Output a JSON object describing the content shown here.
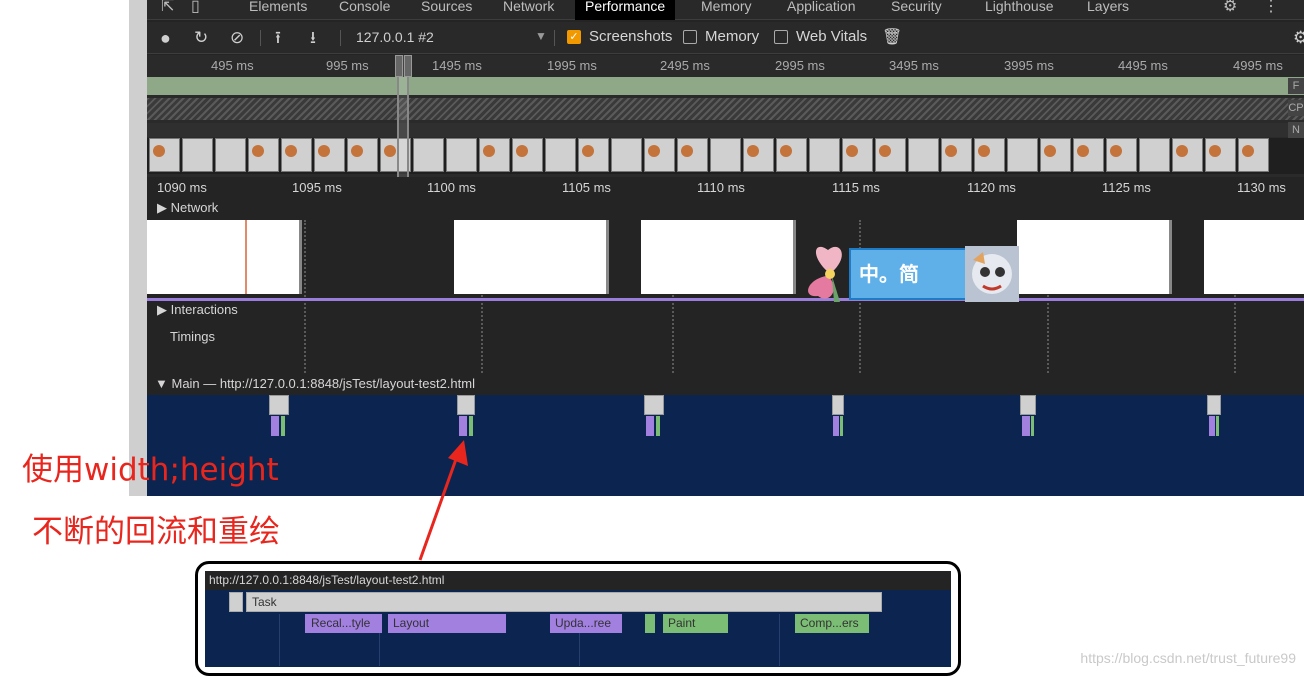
{
  "tabs": [
    "Elements",
    "Console",
    "Sources",
    "Network",
    "Performance",
    "Memory",
    "Application",
    "Security",
    "Lighthouse",
    "Layers"
  ],
  "active_tab": "Performance",
  "toolbar": {
    "profile": "127.0.0.1 #2",
    "screenshots_label": "Screenshots",
    "memory_label": "Memory",
    "webvitals_label": "Web Vitals"
  },
  "overview": {
    "ticks": [
      "495 ms",
      "995 ms",
      "1495 ms",
      "1995 ms",
      "2495 ms",
      "2995 ms",
      "3495 ms",
      "3995 ms",
      "4495 ms",
      "4995 ms"
    ],
    "fps_label": "F",
    "cpu_label": "CP",
    "net_label": "N"
  },
  "ruler": {
    "ticks": [
      "1090 ms",
      "1095 ms",
      "1100 ms",
      "1105 ms",
      "1110 ms",
      "1115 ms",
      "1120 ms",
      "1125 ms",
      "1130 ms"
    ]
  },
  "tracks": {
    "network": "Network",
    "interactions": "Interactions",
    "timings": "Timings",
    "main": "Main — http://127.0.0.1:8848/jsTest/layout-test2.html"
  },
  "sticker": {
    "text": "中。简"
  },
  "annotation": {
    "line1": "使用width;height",
    "line2": "不断的回流和重绘"
  },
  "zoom": {
    "url": "http://127.0.0.1:8848/jsTest/layout-test2.html",
    "task": "Task",
    "recalc": "Recal...tyle",
    "layout": "Layout",
    "update": "Upda...ree",
    "paint": "Paint",
    "composite": "Comp...ers"
  },
  "watermark": "https://blog.csdn.net/trust_future99",
  "colors": {
    "accent_orange": "#f29900",
    "annotation_red": "#e8261e",
    "main_track_bg": "#0b2550",
    "layout_purple": "#a180e0",
    "paint_green": "#7bbd75"
  }
}
